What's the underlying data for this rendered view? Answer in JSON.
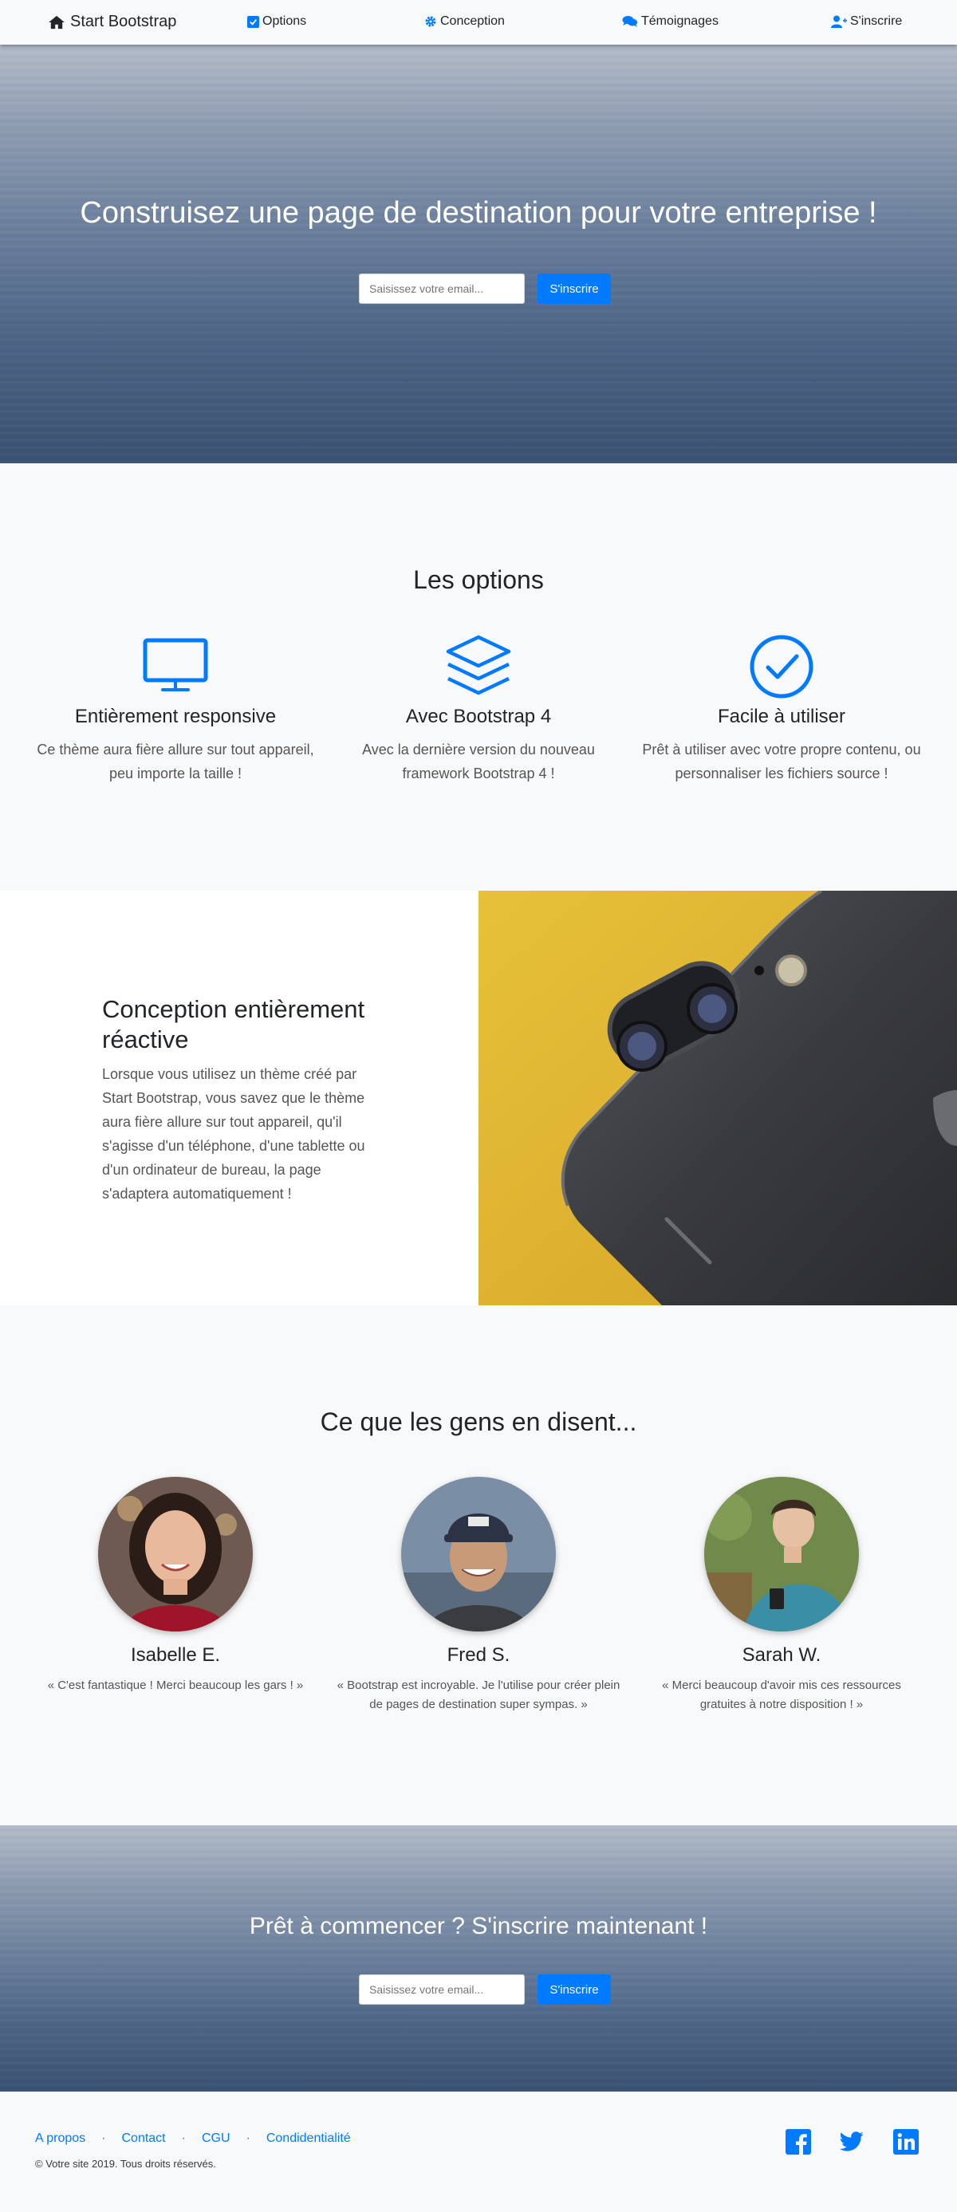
{
  "nav": {
    "brand": "Start Bootstrap",
    "items": [
      {
        "label": "Options",
        "icon": "check-square-icon"
      },
      {
        "label": "Conception",
        "icon": "cog-icon"
      },
      {
        "label": "Témoignages",
        "icon": "comments-icon"
      },
      {
        "label": "S'inscrire",
        "icon": "user-plus-icon"
      }
    ]
  },
  "hero": {
    "title": "Construisez une page de destination pour votre entreprise !",
    "email_placeholder": "Saisissez votre email...",
    "button": "S'inscrire"
  },
  "features": {
    "title": "Les options",
    "items": [
      {
        "icon": "monitor-icon",
        "title": "Entièrement responsive",
        "text": "Ce thème aura fière allure sur tout appareil, peu importe la taille !"
      },
      {
        "icon": "layers-icon",
        "title": "Avec Bootstrap 4",
        "text": "Avec la dernière version du nouveau framework Bootstrap 4 !"
      },
      {
        "icon": "check-circle-icon",
        "title": "Facile à utiliser",
        "text": "Prêt à utiliser avec votre propre contenu, ou personnaliser les fichiers source !"
      }
    ]
  },
  "showcase": {
    "title": "Conception entièrement réactive",
    "body": "Lorsque vous utilisez un thème créé par Start Bootstrap, vous savez que le thème aura fière allure sur tout appareil, qu'il s'agisse d'un téléphone, d'une tablette ou d'un ordinateur de bureau, la page s'adaptera automatiquement !"
  },
  "testimonials": {
    "title": "Ce que les gens en disent...",
    "items": [
      {
        "name": "Isabelle E.",
        "quote": "« C'est fantastique ! Merci beaucoup les gars ! »"
      },
      {
        "name": "Fred S.",
        "quote": "« Bootstrap est incroyable. Je l'utilise pour créer plein de pages de destination super sympas. »"
      },
      {
        "name": "Sarah W.",
        "quote": "« Merci beaucoup d'avoir mis ces ressources gratuites à notre disposition ! »"
      }
    ]
  },
  "cta": {
    "title": "Prêt à commencer ? S'inscrire maintenant !",
    "email_placeholder": "Saisissez votre email...",
    "button": "S'inscrire"
  },
  "footer": {
    "links": [
      "A propos",
      "Contact",
      "CGU",
      "Condidentialité"
    ],
    "separator": "·",
    "copyright": "© Votre site 2019. Tous droits réservés.",
    "social": [
      "facebook-icon",
      "twitter-icon",
      "linkedin-icon"
    ]
  },
  "colors": {
    "primary": "#007bff",
    "light": "#f8f9fa",
    "dark": "#212529"
  }
}
